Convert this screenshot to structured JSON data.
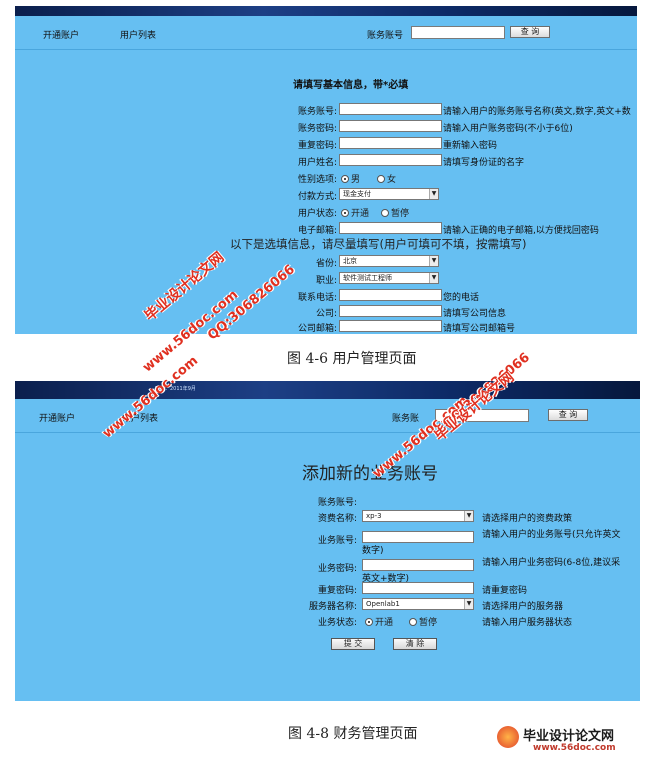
{
  "top": {
    "banner": {
      "left": "",
      "right": ""
    },
    "nav": {
      "open_account": "开通账户",
      "user_list": "用户列表",
      "search_label": "账务账号",
      "query": "查 询"
    },
    "title": "请填写基本信息，带*必填",
    "fields": [
      {
        "label": "账务账号:",
        "hint": "请输入用户的账务账号名称(英文,数字,英文+数"
      },
      {
        "label": "账务密码:",
        "hint": "请输入用户账务密码(不小于6位)"
      },
      {
        "label": "重复密码:",
        "hint": "重新输入密码"
      },
      {
        "label": "用户姓名:",
        "hint": "请填写身份证的名字"
      }
    ],
    "gender": {
      "label": "性别选项:",
      "male": "男",
      "female": "女"
    },
    "payment": {
      "label": "付款方式:",
      "value": "现金支付"
    },
    "status": {
      "label": "用户状态:",
      "on": "开通",
      "off": "暂停"
    },
    "email": {
      "label": "电子邮箱:",
      "hint": "请输入正确的电子邮箱,以方便找回密码"
    },
    "optional_note": "以下是选填信息，请尽量填写(用户可填可不填，按需填写)",
    "province": {
      "label": "省份:",
      "value": "北京"
    },
    "job": {
      "label": "职业:",
      "value": "软件测试工程师"
    },
    "phone": {
      "label": "联系电话:",
      "hint": "您的电话"
    },
    "company": {
      "label": "公司:",
      "hint": "请填写公司信息"
    },
    "company_email": {
      "label": "公司邮箱:",
      "hint": "请填写公司邮箱号"
    }
  },
  "caption1": "图 4-6 用户管理页面",
  "bottom": {
    "banner": {
      "left": "时间：2011年9月",
      "right": ""
    },
    "nav": {
      "open_account": "开通账户",
      "user_list": "用户列表",
      "search_label": "账务账",
      "query": "查 询"
    },
    "title": "添加新的业务账号",
    "account": {
      "label": "账务账号:"
    },
    "plan": {
      "label": "资费名称:",
      "value": "xp-3",
      "hint": "请选择用户的资费政策"
    },
    "biz_account": {
      "label": "业务账号:",
      "hint": "请输入用户的业务账号(只允许英文",
      "hint2": "数字)"
    },
    "biz_password": {
      "label": "业务密码:",
      "hint": "请输入用户业务密码(6-8位,建议采",
      "hint2": "英文+数字)"
    },
    "repeat": {
      "label": "重复密码:",
      "hint": "请重复密码"
    },
    "server": {
      "label": "服务器名称:",
      "value": "Openlab1",
      "hint": "请选择用户的服务器"
    },
    "biz_status": {
      "label": "业务状态:",
      "on": "开通",
      "off": "暂停",
      "hint": "请输入用户服务器状态"
    },
    "submit": "提 交",
    "clear": "清 除"
  },
  "caption2": "图 4-8 财务管理页面",
  "watermarks": {
    "site_a": "毕业设计论文网",
    "url": "www.56doc.com",
    "qq": "QQ:306826066",
    "logo_text": "毕业设计论文网",
    "logo_url": "www.56doc.com"
  }
}
